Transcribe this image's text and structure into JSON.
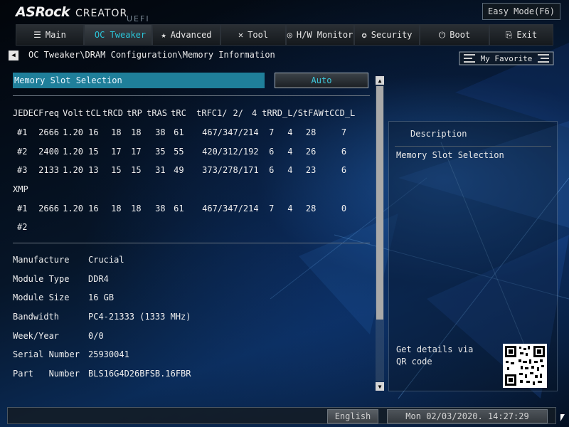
{
  "header": {
    "brand": "ASRock",
    "product": "CREATOR",
    "firmware": "UEFI",
    "easy_mode": "Easy Mode(F6)"
  },
  "tabs": [
    {
      "label": "Main",
      "icon": "list-icon",
      "glyph": "☰",
      "active": false
    },
    {
      "label": "OC Tweaker",
      "icon": "rocket-icon",
      "glyph": "",
      "active": true
    },
    {
      "label": "Advanced",
      "icon": "star-icon",
      "glyph": "★",
      "active": false
    },
    {
      "label": "Tool",
      "icon": "tools-icon",
      "glyph": "✕",
      "active": false
    },
    {
      "label": "H/W Monitor",
      "icon": "monitor-icon",
      "glyph": "◎",
      "active": false
    },
    {
      "label": "Security",
      "icon": "shield-icon",
      "glyph": "✪",
      "active": false
    },
    {
      "label": "Boot",
      "icon": "power-icon",
      "glyph": "⏻",
      "active": false
    },
    {
      "label": "Exit",
      "icon": "exit-icon",
      "glyph": "⎘",
      "active": false
    }
  ],
  "breadcrumb": "OC Tweaker\\DRAM Configuration\\Memory Information",
  "my_favorite": "My Favorite",
  "slot_selection": {
    "label": "Memory Slot Selection",
    "value": "Auto"
  },
  "timing_table": {
    "headers": [
      "JEDEC",
      "Freq",
      "Volt",
      "tCL",
      "tRCD",
      "tRP",
      "tRAS",
      "tRC",
      "tRFC1/",
      "2/",
      "4",
      "tRRD_L/S",
      "tFAW",
      "tCCD_L"
    ],
    "jedec_rows": [
      {
        "id": "#1",
        "freq": "2666",
        "volt": "1.20",
        "tcl": "16",
        "trcd": "18",
        "trp": "18",
        "tras": "38",
        "trc": "61",
        "trfc": "467/347/214",
        "trrd_l": "7",
        "trrd_s": "4",
        "tfaw": "28",
        "tccd_l": "7"
      },
      {
        "id": "#2",
        "freq": "2400",
        "volt": "1.20",
        "tcl": "15",
        "trcd": "17",
        "trp": "17",
        "tras": "35",
        "trc": "55",
        "trfc": "420/312/192",
        "trrd_l": "6",
        "trrd_s": "4",
        "tfaw": "26",
        "tccd_l": "6"
      },
      {
        "id": "#3",
        "freq": "2133",
        "volt": "1.20",
        "tcl": "13",
        "trcd": "15",
        "trp": "15",
        "tras": "31",
        "trc": "49",
        "trfc": "373/278/171",
        "trrd_l": "6",
        "trrd_s": "4",
        "tfaw": "23",
        "tccd_l": "6"
      }
    ],
    "xmp_label": "XMP",
    "xmp_rows": [
      {
        "id": "#1",
        "freq": "2666",
        "volt": "1.20",
        "tcl": "16",
        "trcd": "18",
        "trp": "18",
        "tras": "38",
        "trc": "61",
        "trfc": "467/347/214",
        "trrd_l": "7",
        "trrd_s": "4",
        "tfaw": "28",
        "tccd_l": "0"
      },
      {
        "id": "#2",
        "freq": "",
        "volt": "",
        "tcl": "",
        "trcd": "",
        "trp": "",
        "tras": "",
        "trc": "",
        "trfc": "",
        "trrd_l": "",
        "trrd_s": "",
        "tfaw": "",
        "tccd_l": ""
      }
    ]
  },
  "module_info": [
    {
      "key": "Manufacture",
      "value": "Crucial"
    },
    {
      "key": "Module Type",
      "value": "DDR4"
    },
    {
      "key": "Module Size",
      "value": "16 GB"
    },
    {
      "key": "Bandwidth",
      "value": "PC4-21333 (1333 MHz)"
    },
    {
      "key": "Week/Year",
      "value": "0/0"
    },
    {
      "key": "Serial Number",
      "value": "25930041"
    },
    {
      "key": "Part   Number",
      "value": "BLS16G4D26BFSB.16FBR"
    }
  ],
  "description": {
    "title": "Description",
    "text": "Memory Slot Selection",
    "qr_text": "Get details via QR code"
  },
  "footer": {
    "language": "English",
    "datetime": "Mon 02/03/2020. 14:27:29"
  },
  "colors": {
    "accent": "#2bc3d7",
    "selection": "#1f7f9a"
  }
}
